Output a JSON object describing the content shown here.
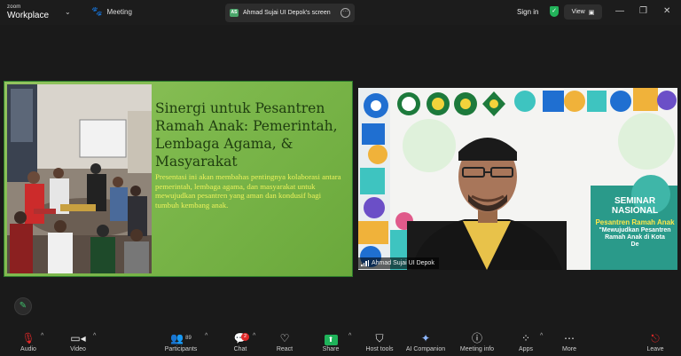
{
  "titlebar": {
    "brand_small": "zoom",
    "brand_product": "Workplace",
    "meeting_label": "Meeting",
    "share_badge": "AS",
    "share_title": "Ahmad Sujai UI Depok's screen",
    "signin_label": "Sign in",
    "view_label": "View"
  },
  "slide": {
    "title": "Sinergi untuk Pesantren Ramah Anak: Pemerintah, Lembaga Agama, & Masyarakat",
    "body": "Presentasi ini akan membahas pentingnya kolaborasi antara pemerintah, lembaga agama, dan masyarakat untuk mewujudkan pesantren yang aman dan kondusif bagi tumbuh kembang anak."
  },
  "video": {
    "participant_name": "Ahmad Sujai UI Depok",
    "banner_line1": "SEMINAR",
    "banner_line2": "NASIONAL",
    "banner_line3": "Pesantren Ramah Anak",
    "banner_line4": "\"Mewujudkan Pesantren",
    "banner_line5": "Ramah Anak di Kota",
    "banner_line6": "De"
  },
  "toolbar": {
    "audio": "Audio",
    "video": "Video",
    "participants": "Participants",
    "participants_count": "89",
    "chat": "Chat",
    "chat_badge": "2",
    "react": "React",
    "share": "Share",
    "host_tools": "Host tools",
    "ai_companion": "AI Companion",
    "meeting_info": "Meeting info",
    "apps": "Apps",
    "more": "More",
    "leave": "Leave"
  },
  "colors": {
    "share_green": "#1fb35a",
    "chat_badge": "#e02828",
    "leave_red": "#e02828",
    "slide_green": "#7db84c"
  }
}
